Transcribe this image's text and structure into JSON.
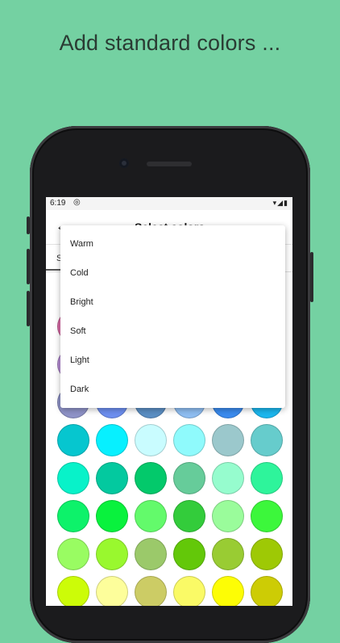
{
  "promo": {
    "title": "Add standard colors ..."
  },
  "status_bar": {
    "time": "6:19",
    "sync_icon": "sync-icon",
    "signal_icons": "▾◢▮"
  },
  "app_bar": {
    "title": "Select colors",
    "back_icon": "arrow-back-icon"
  },
  "tabs": [
    {
      "label": "S"
    }
  ],
  "menu": {
    "items": [
      {
        "label": "Warm"
      },
      {
        "label": "Cold"
      },
      {
        "label": "Bright"
      },
      {
        "label": "Soft"
      },
      {
        "label": "Light"
      },
      {
        "label": "Dark"
      }
    ]
  },
  "swatch_rows": [
    [
      "#d86aa5"
    ],
    [
      "#b48bd2"
    ],
    [
      "#8f93c8",
      "#6d8ff0",
      "#5b8fc4",
      "#8fbef2",
      "#3a8bef",
      "#1bb7ef"
    ],
    [
      "#06c6cf",
      "#07f0ff",
      "#c9fcff",
      "#8ffafc",
      "#9bc8cc",
      "#66cccc"
    ],
    [
      "#08f2c9",
      "#03c99f",
      "#03c96b",
      "#66cc9a",
      "#96fcce",
      "#2ef49b"
    ],
    [
      "#0df26a",
      "#09f23d",
      "#63fa6b",
      "#33cc3b",
      "#9afc9b",
      "#3cf73b"
    ],
    [
      "#99fc62",
      "#99f82e",
      "#9bc96a",
      "#63c809",
      "#99cc33",
      "#9ec905"
    ],
    [
      "#ccfc08",
      "#fdfe9b",
      "#cccc65",
      "#fafa66",
      "#fdfd05",
      "#cdcc05"
    ]
  ]
}
